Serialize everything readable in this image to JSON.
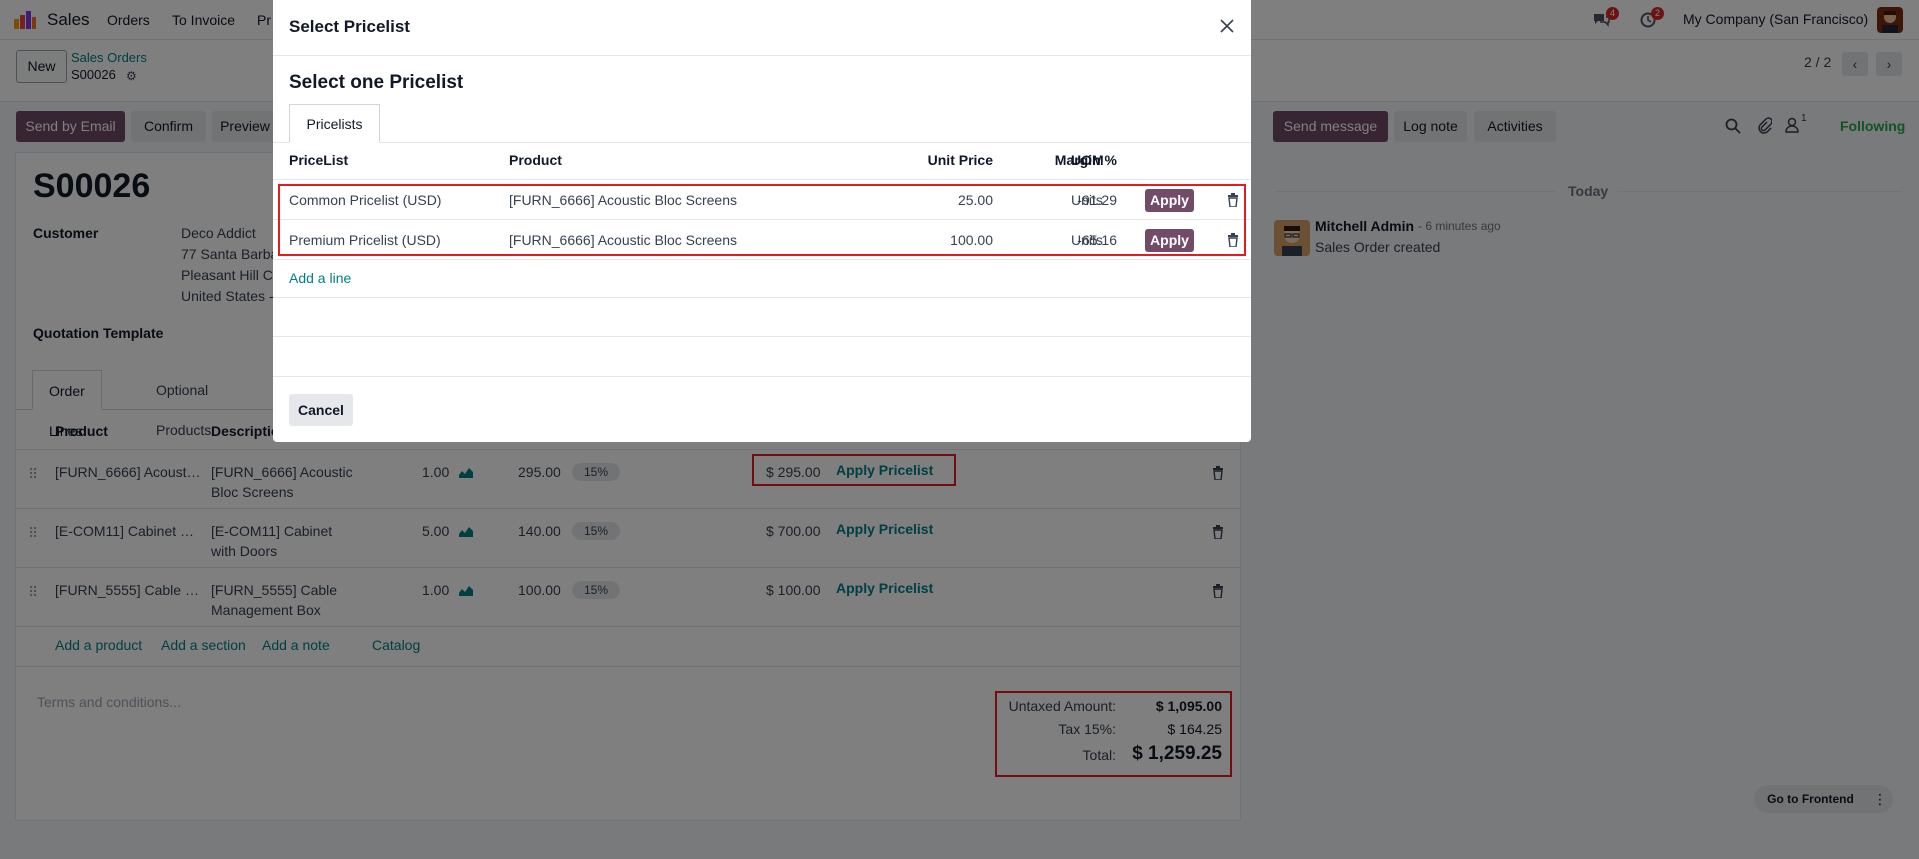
{
  "navbar": {
    "app_name": "Sales",
    "menu": [
      "Orders",
      "To Invoice",
      "Pr"
    ],
    "messages_count": "4",
    "activities_count": "2",
    "company": "My Company (San Francisco)"
  },
  "control": {
    "new_label": "New",
    "breadcrumb_parent": "Sales Orders",
    "breadcrumb_current": "S00026",
    "pager": "2 / 2"
  },
  "actions": {
    "send_email": "Send by Email",
    "confirm": "Confirm",
    "preview": "Preview"
  },
  "order": {
    "name": "S00026",
    "customer_label": "Customer",
    "customer_name": "Deco Addict",
    "address_lines": [
      "77 Santa Barba",
      "Pleasant Hill C",
      "United States -"
    ],
    "template_label": "Quotation Template",
    "tabs": [
      "Order Lines",
      "Optional Products"
    ],
    "columns": {
      "product": "Product",
      "description": "Descriptio"
    },
    "lines": [
      {
        "product": "[FURN_6666] Acoust…",
        "desc1": "[FURN_6666] Acoustic",
        "desc2": "Bloc Screens",
        "qty": "1.00",
        "price": "295.00",
        "tax": "15%",
        "subtotal": "$ 295.00",
        "apply": "Apply Pricelist"
      },
      {
        "product": "[E-COM11] Cabinet …",
        "desc1": "[E-COM11] Cabinet",
        "desc2": "with Doors",
        "qty": "5.00",
        "price": "140.00",
        "tax": "15%",
        "subtotal": "$ 700.00",
        "apply": "Apply Pricelist"
      },
      {
        "product": "[FURN_5555] Cable …",
        "desc1": "[FURN_5555] Cable",
        "desc2": "Management Box",
        "qty": "1.00",
        "price": "100.00",
        "tax": "15%",
        "subtotal": "$ 100.00",
        "apply": "Apply Pricelist"
      }
    ],
    "add_links": [
      "Add a product",
      "Add a section",
      "Add a note",
      "Catalog"
    ],
    "terms_placeholder": "Terms and conditions...",
    "totals": {
      "untaxed_label": "Untaxed Amount:",
      "untaxed_value": "$ 1,095.00",
      "tax_label": "Tax 15%:",
      "tax_value": "$ 164.25",
      "total_label": "Total:",
      "total_value": "$ 1,259.25"
    }
  },
  "chatter": {
    "send_message": "Send message",
    "log_note": "Log note",
    "activities": "Activities",
    "followers_count": "1",
    "following": "Following",
    "today": "Today",
    "author": "Mitchell Admin",
    "time": "- 6 minutes ago",
    "body": "Sales Order created",
    "goto_frontend": "Go to Frontend"
  },
  "modal": {
    "title": "Select Pricelist",
    "subtitle": "Select one Pricelist",
    "tab": "Pricelists",
    "columns": {
      "pricelist": "PriceList",
      "product": "Product",
      "unit_price": "Unit Price",
      "margin": "Margin %",
      "uom": "UOM"
    },
    "rows": [
      {
        "pricelist": "Common Pricelist (USD)",
        "product": "[FURN_6666] Acoustic Bloc Screens",
        "unit_price": "25.00",
        "margin": "-91.29",
        "uom": "Units",
        "apply": "Apply"
      },
      {
        "pricelist": "Premium Pricelist (USD)",
        "product": "[FURN_6666] Acoustic Bloc Screens",
        "unit_price": "100.00",
        "margin": "-65.16",
        "uom": "Units",
        "apply": "Apply"
      }
    ],
    "add_line": "Add a line",
    "cancel": "Cancel"
  },
  "colors": {
    "primary": "#714b67",
    "link": "#017e84",
    "highlight": "#e11d24",
    "following": "#28a745"
  }
}
